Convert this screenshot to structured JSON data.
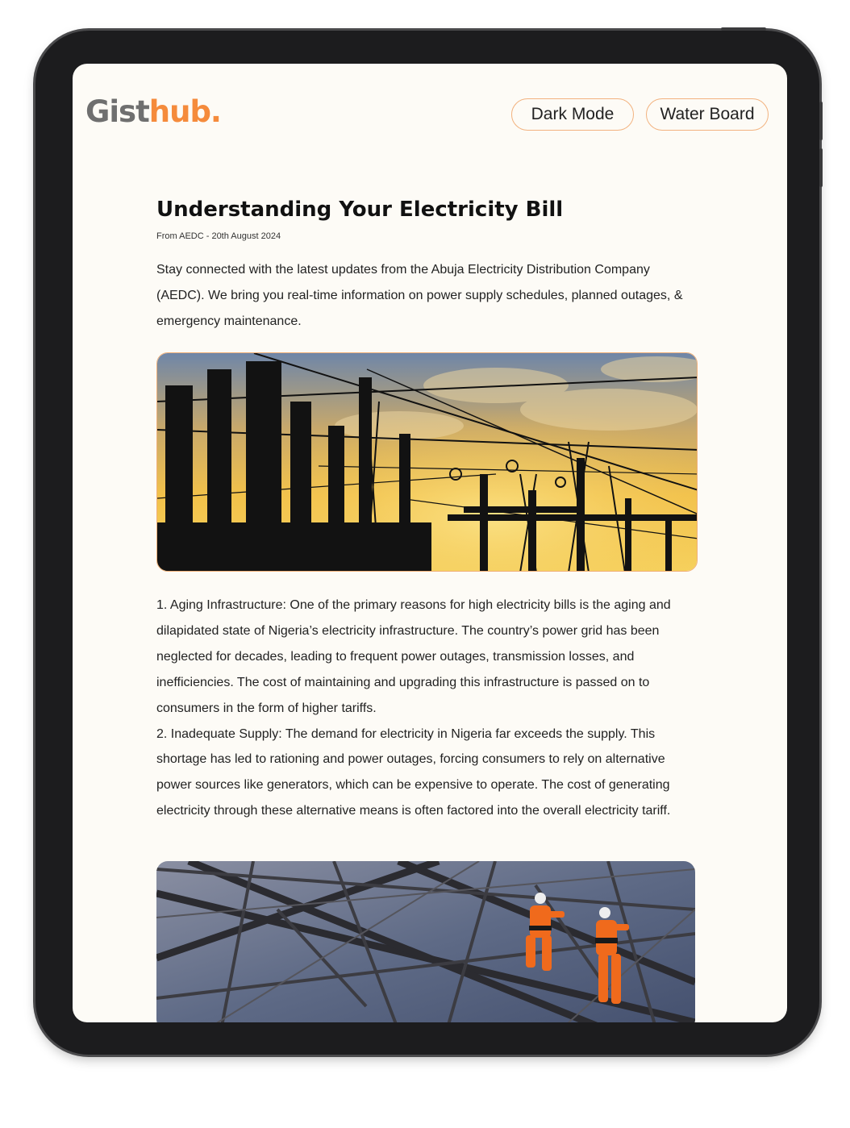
{
  "header": {
    "logo_part1": "Gist",
    "logo_part2": "hub.",
    "dark_mode_label": "Dark Mode",
    "water_board_label": "Water Board"
  },
  "article": {
    "title": "Understanding Your Electricity Bill",
    "meta": "From AEDC - 20th August 2024",
    "intro": "Stay connected with the latest updates from the Abuja Electricity Distribution Company (AEDC). We bring you real-time information on power supply schedules, planned outages, & emergency maintenance.",
    "point1": "1. Aging Infrastructure: One of the primary reasons for high electricity bills is the aging and dilapidated state of Nigeria’s electricity infrastructure. The country’s power grid has been neglected for decades, leading to frequent power outages, transmission losses, and inefficiencies. The cost of maintaining and upgrading this infrastructure is passed on to consumers in the form of higher tariffs.",
    "point2": "2. Inadequate Supply: The demand for electricity in Nigeria far exceeds the supply. This shortage has led to rationing and power outages, forcing consumers to rely on alternative power sources like generators, which can be expensive to operate. The cost of generating electricity through these alternative means is often factored into the overall electricity tariff."
  },
  "colors": {
    "accent": "#f58b3c",
    "logo_gray": "#6f6f6f",
    "page_bg": "#fdfbf6",
    "device_frame": "#1c1c1e"
  }
}
